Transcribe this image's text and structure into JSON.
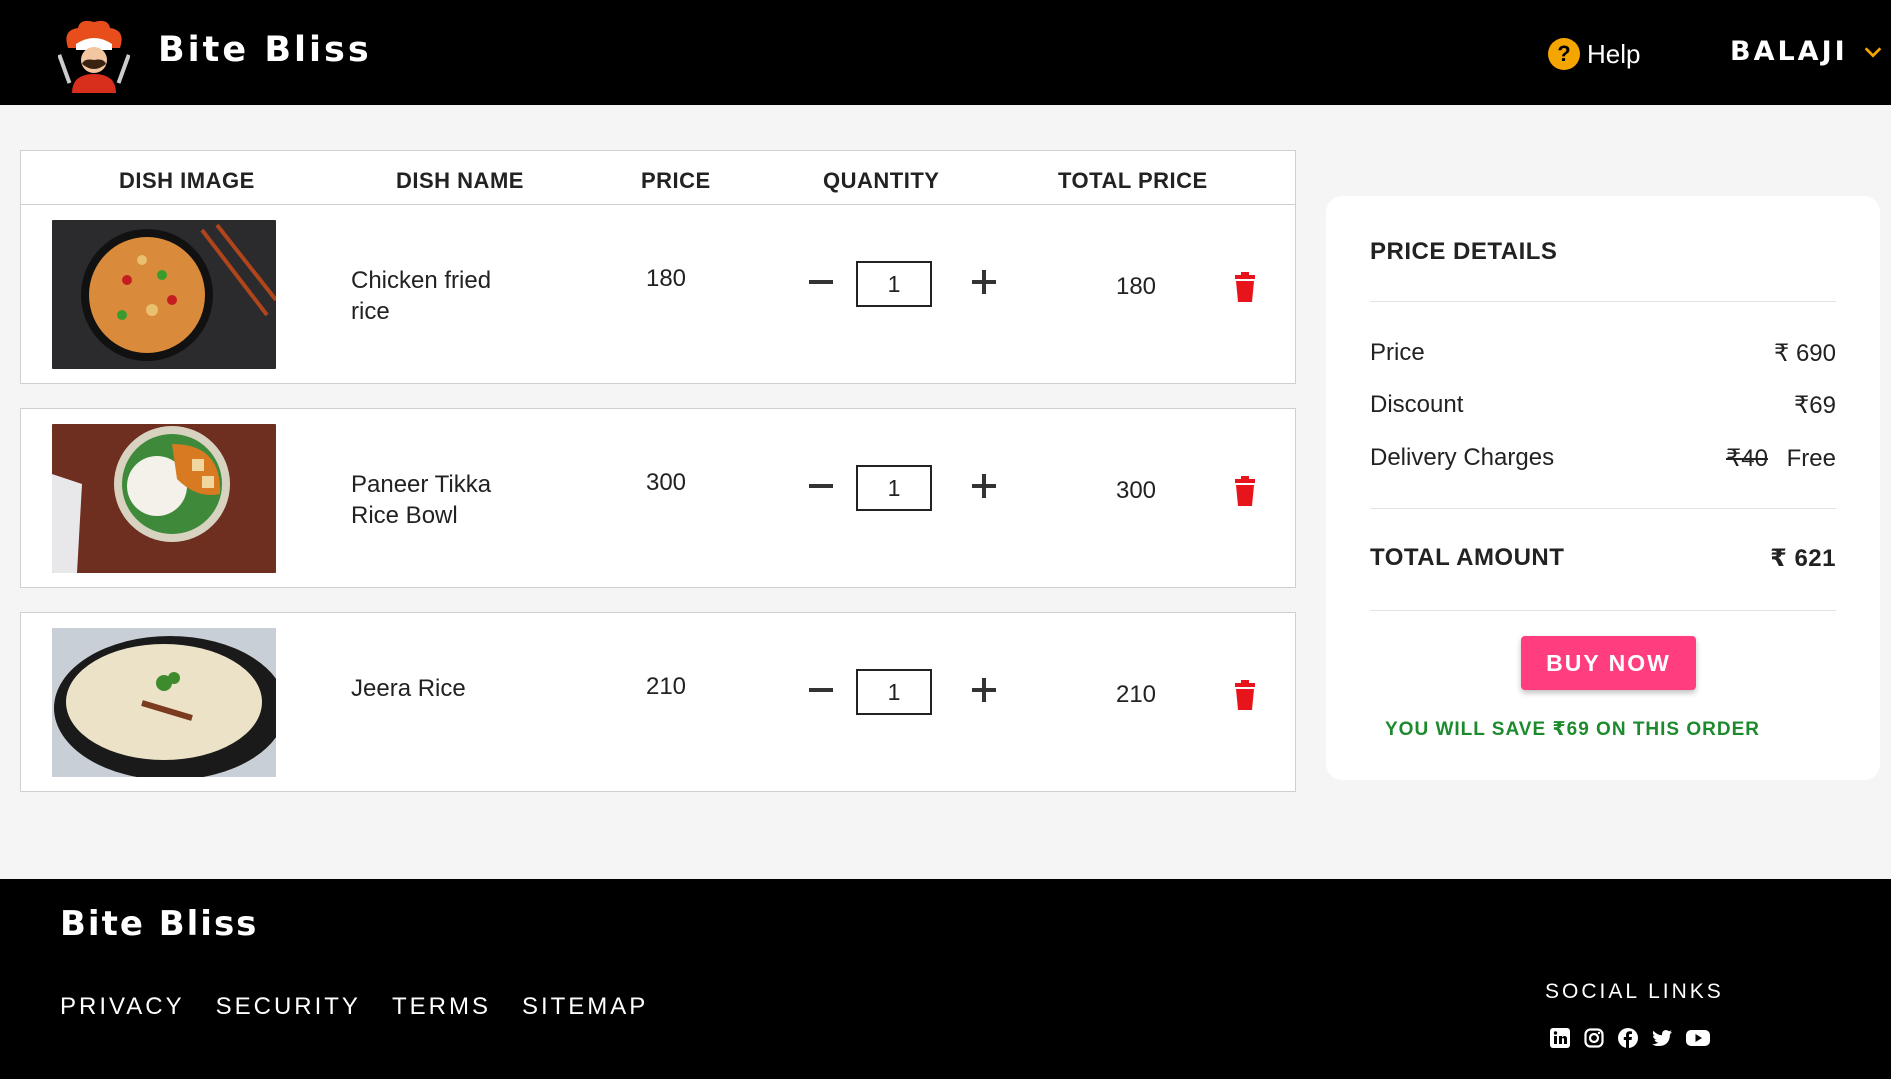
{
  "header": {
    "brand": "Bite Bliss",
    "help_label": "Help",
    "help_icon": "?",
    "user_name": "BALAJI"
  },
  "table": {
    "headers": {
      "image": "DISH IMAGE",
      "name": "DISH NAME",
      "price": "PRICE",
      "quantity": "QUANTITY",
      "total": "TOTAL PRICE"
    },
    "rows": [
      {
        "name": "Chicken fried rice",
        "price": "180",
        "quantity": "1",
        "total": "180",
        "image": "fried-rice-bowl"
      },
      {
        "name": "Paneer Tikka Rice Bowl",
        "price": "300",
        "quantity": "1",
        "total": "300",
        "image": "paneer-rice-bowl"
      },
      {
        "name": "Jeera Rice",
        "price": "210",
        "quantity": "1",
        "total": "210",
        "image": "jeera-rice-plate"
      }
    ]
  },
  "price_details": {
    "title": "PRICE DETAILS",
    "price_label": "Price",
    "price_value": "₹ 690",
    "discount_label": "Discount",
    "discount_value": "₹69",
    "delivery_label": "Delivery Charges",
    "delivery_original": "₹40",
    "delivery_value": "Free",
    "total_label": "TOTAL AMOUNT",
    "total_value": "₹ 621",
    "buy_label": "BUY NOW",
    "save_note": "YOU WILL SAVE ₹69 ON THIS ORDER"
  },
  "footer": {
    "brand": "Bite Bliss",
    "links": [
      "PRIVACY",
      "SECURITY",
      "TERMS",
      "SITEMAP"
    ],
    "social_title": "SOCIAL LINKS",
    "social_icons": [
      "linkedin-icon",
      "instagram-icon",
      "facebook-icon",
      "twitter-icon",
      "youtube-icon"
    ]
  },
  "colors": {
    "header_bg": "#000000",
    "page_bg": "#f5f5f5",
    "accent_buy": "#ff3d7f",
    "save_green": "#1e8a2e",
    "trash_red": "#e8141c",
    "help_yellow": "#f5a500"
  }
}
